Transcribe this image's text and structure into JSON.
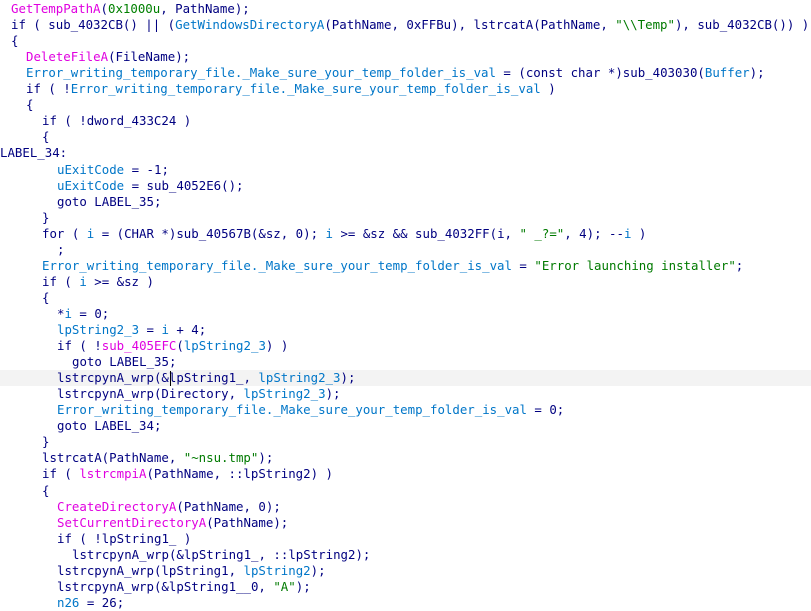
{
  "colors": {
    "background": "#ffffff",
    "plain": "#000080",
    "function": "#e000e0",
    "variable": "#0076c8",
    "string": "#007a00",
    "highlight_line": "#f3f3f3"
  },
  "lines": [
    [
      [
        "fn",
        "GetTempPathA"
      ],
      [
        "pl",
        "("
      ],
      [
        "num",
        "0x1000u"
      ],
      [
        "pl",
        ", PathName);"
      ]
    ],
    [
      [
        "kw",
        "if"
      ],
      [
        "pl",
        " ( sub_4032CB() || ("
      ],
      [
        "var",
        "GetWindowsDirectoryA"
      ],
      [
        "pl",
        "(PathName, 0xFFBu), lstrcatA(PathName, "
      ],
      [
        "str",
        "\"\\\\Temp\""
      ],
      [
        "pl",
        "), sub_4032CB()) )"
      ]
    ],
    [
      [
        "pl",
        "{"
      ]
    ],
    [
      [
        "fn",
        "DeleteFileA"
      ],
      [
        "pl",
        "(FileName);"
      ]
    ],
    [
      [
        "var",
        "Error_writing_temporary_file._Make_sure_your_temp_folder_is_val"
      ],
      [
        "pl",
        " = ("
      ],
      [
        "kw",
        "const char"
      ],
      [
        "pl",
        " *)sub_403030("
      ],
      [
        "var",
        "Buffer"
      ],
      [
        "pl",
        ");"
      ]
    ],
    [
      [
        "kw",
        "if"
      ],
      [
        "pl",
        " ( !"
      ],
      [
        "var",
        "Error_writing_temporary_file._Make_sure_your_temp_folder_is_val"
      ],
      [
        "pl",
        " )"
      ]
    ],
    [
      [
        "pl",
        "{"
      ]
    ],
    [
      [
        "kw",
        "if"
      ],
      [
        "pl",
        " ( !dword_433C24 )"
      ]
    ],
    [
      [
        "pl",
        "{"
      ]
    ],
    [
      [
        "lbl",
        "LABEL_34:"
      ]
    ],
    [
      [
        "var",
        "uExitCode"
      ],
      [
        "pl",
        " = -1;"
      ]
    ],
    [
      [
        "var",
        "uExitCode"
      ],
      [
        "pl",
        " = sub_4052E6();"
      ]
    ],
    [
      [
        "kw",
        "goto"
      ],
      [
        "pl",
        " LABEL_35;"
      ]
    ],
    [
      [
        "pl",
        "}"
      ]
    ],
    [
      [
        "kw",
        "for"
      ],
      [
        "pl",
        " ( "
      ],
      [
        "var",
        "i"
      ],
      [
        "pl",
        " = ("
      ],
      [
        "kw",
        "CHAR"
      ],
      [
        "pl",
        " *)sub_40567B(&sz, 0); "
      ],
      [
        "var",
        "i"
      ],
      [
        "pl",
        " >= &sz && sub_4032FF(i, "
      ],
      [
        "str",
        "\" _?=\""
      ],
      [
        "pl",
        ", 4); --"
      ],
      [
        "var",
        "i"
      ],
      [
        "pl",
        " )"
      ]
    ],
    [
      [
        "pl",
        ";"
      ]
    ],
    [
      [
        "var",
        "Error_writing_temporary_file._Make_sure_your_temp_folder_is_val"
      ],
      [
        "pl",
        " = "
      ],
      [
        "str",
        "\"Error launching installer\""
      ],
      [
        "pl",
        ";"
      ]
    ],
    [
      [
        "kw",
        "if"
      ],
      [
        "pl",
        " ( "
      ],
      [
        "var",
        "i"
      ],
      [
        "pl",
        " >= &sz )"
      ]
    ],
    [
      [
        "pl",
        "{"
      ]
    ],
    [
      [
        "pl",
        "*"
      ],
      [
        "var",
        "i"
      ],
      [
        "pl",
        " = 0;"
      ]
    ],
    [
      [
        "var",
        "lpString2_3"
      ],
      [
        "pl",
        " = "
      ],
      [
        "var",
        "i"
      ],
      [
        "pl",
        " + 4;"
      ]
    ],
    [
      [
        "kw",
        "if"
      ],
      [
        "pl",
        " ( !"
      ],
      [
        "fn",
        "sub_405EFC"
      ],
      [
        "pl",
        "("
      ],
      [
        "var",
        "lpString2_3"
      ],
      [
        "pl",
        ") )"
      ]
    ],
    [
      [
        "kw",
        "goto"
      ],
      [
        "pl",
        " LABEL_35;"
      ]
    ],
    [
      [
        "pl",
        "lstrcpynA_wrp(&lpString1_, "
      ],
      [
        "var",
        "lpString2_3"
      ],
      [
        "pl",
        ");"
      ]
    ],
    [
      [
        "pl",
        "lstrcpynA_wrp(Directory, "
      ],
      [
        "var",
        "lpString2_3"
      ],
      [
        "pl",
        ");"
      ]
    ],
    [
      [
        "var",
        "Error_writing_temporary_file._Make_sure_your_temp_folder_is_val"
      ],
      [
        "pl",
        " = 0;"
      ]
    ],
    [
      [
        "kw",
        "goto"
      ],
      [
        "pl",
        " LABEL_34;"
      ]
    ],
    [
      [
        "pl",
        "}"
      ]
    ],
    [
      [
        "pl",
        "lstrcatA(PathName, "
      ],
      [
        "str",
        "\"~nsu.tmp\""
      ],
      [
        "pl",
        ");"
      ]
    ],
    [
      [
        "kw",
        "if"
      ],
      [
        "pl",
        " ( "
      ],
      [
        "fn",
        "lstrcmpiA"
      ],
      [
        "pl",
        "(PathName, ::lpString2) )"
      ]
    ],
    [
      [
        "pl",
        "{"
      ]
    ],
    [
      [
        "fn",
        "CreateDirectoryA"
      ],
      [
        "pl",
        "(PathName, 0);"
      ]
    ],
    [
      [
        "fn",
        "SetCurrentDirectoryA"
      ],
      [
        "pl",
        "(PathName);"
      ]
    ],
    [
      [
        "kw",
        "if"
      ],
      [
        "pl",
        " ( !lpString1_ )"
      ]
    ],
    [
      [
        "pl",
        "lstrcpynA_wrp(&lpString1_, ::lpString2);"
      ]
    ],
    [
      [
        "pl",
        "lstrcpynA_wrp(lpString1, "
      ],
      [
        "var",
        "lpString2"
      ],
      [
        "pl",
        ");"
      ]
    ],
    [
      [
        "pl",
        "lstrcpynA_wrp(&lpString1__0, "
      ],
      [
        "str",
        "\"A\""
      ],
      [
        "pl",
        ");"
      ]
    ],
    [
      [
        "var",
        "n26"
      ],
      [
        "pl",
        " = 26;"
      ]
    ]
  ]
}
